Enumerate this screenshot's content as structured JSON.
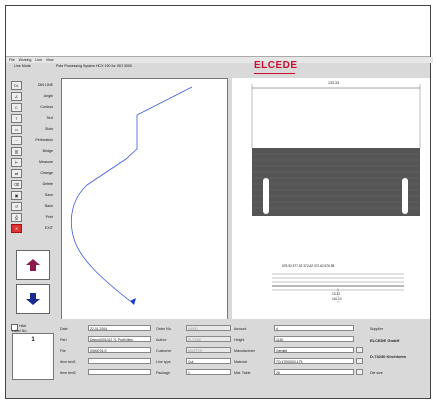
{
  "menu": [
    "File",
    "Working",
    "Line",
    "View"
  ],
  "toolbar": {
    "mode": "Line Mode",
    "app_title": "Pole Processing System HCX 190 for ISO 3000"
  },
  "logo": "ELCEDE",
  "sidebar": [
    {
      "label": "DIN LINE",
      "icon": "din-line-icon",
      "glyph": "DL"
    },
    {
      "label": "Angle",
      "icon": "angle-icon",
      "glyph": "∠"
    },
    {
      "label": "Contour",
      "icon": "contour-icon",
      "glyph": "C"
    },
    {
      "label": "Text",
      "icon": "text-icon",
      "glyph": "T"
    },
    {
      "label": "Slots",
      "icon": "slots-icon",
      "glyph": "▭"
    },
    {
      "label": "Perforation",
      "icon": "perforation-icon",
      "glyph": "⋯"
    },
    {
      "label": "Bridge",
      "icon": "bridge-icon",
      "glyph": "▥"
    },
    {
      "label": "Measure",
      "icon": "measure-icon",
      "glyph": "⊢"
    },
    {
      "label": "Change",
      "icon": "change-icon",
      "glyph": "⇄"
    },
    {
      "label": "Delete",
      "icon": "delete-icon",
      "glyph": "⌫"
    },
    {
      "label": "Save",
      "icon": "save-icon",
      "glyph": "▣"
    },
    {
      "label": "Back",
      "icon": "back-icon",
      "glyph": "↺"
    },
    {
      "label": "Print",
      "icon": "print-icon",
      "glyph": "⎙"
    },
    {
      "label": "EXIT",
      "icon": "exit-icon",
      "glyph": "✕"
    }
  ],
  "drawing": {
    "dimension_top": "133.33",
    "dimension_bottom": "13.32",
    "dimension_bottom2": "110.10",
    "markings": "575.92  577.02  372.62  472.62  576.95"
  },
  "colors": {
    "accent": "#c8102e",
    "curve": "#3b5bdb",
    "nav_arrow": "#1b2a8f",
    "hatch": "#555555"
  },
  "form": {
    "hide_label": "Hide",
    "label_no": "Label No.",
    "page_no": "1",
    "date_label": "Date",
    "date": "22.01.2004",
    "part_label": "Part",
    "part": "Demo0001012 7L Profil Mes",
    "file_label": "File",
    "file": "0000076-S",
    "item_text1_label": "Item text1",
    "item_text1": "",
    "item_text2_label": "Item text2",
    "item_text2": "",
    "order_label": "Order No.",
    "order": "00000",
    "author_label": "Author",
    "author": "ELCEDE",
    "customer_label": "Customer",
    "customer": "MUSTER",
    "line_type_label": "Line type",
    "line_type": "Cut",
    "package_label": "Package",
    "package": "1",
    "amount_label": "Amount",
    "amount": "4",
    "height_label": "Height",
    "height": "1130",
    "manufacturer_label": "Manufacturer",
    "manufacturer": "Gerdelt",
    "material_label": "Material",
    "material": "7Cr170000/0-175",
    "mat_table_label": "Mat. Table",
    "mat_table": "26",
    "supplier_label": "Supplier",
    "supplier_name": "ELCEDE GmbH",
    "supplier_city": "D-73230 Kirchheim",
    "die_size_label": "Die size"
  }
}
